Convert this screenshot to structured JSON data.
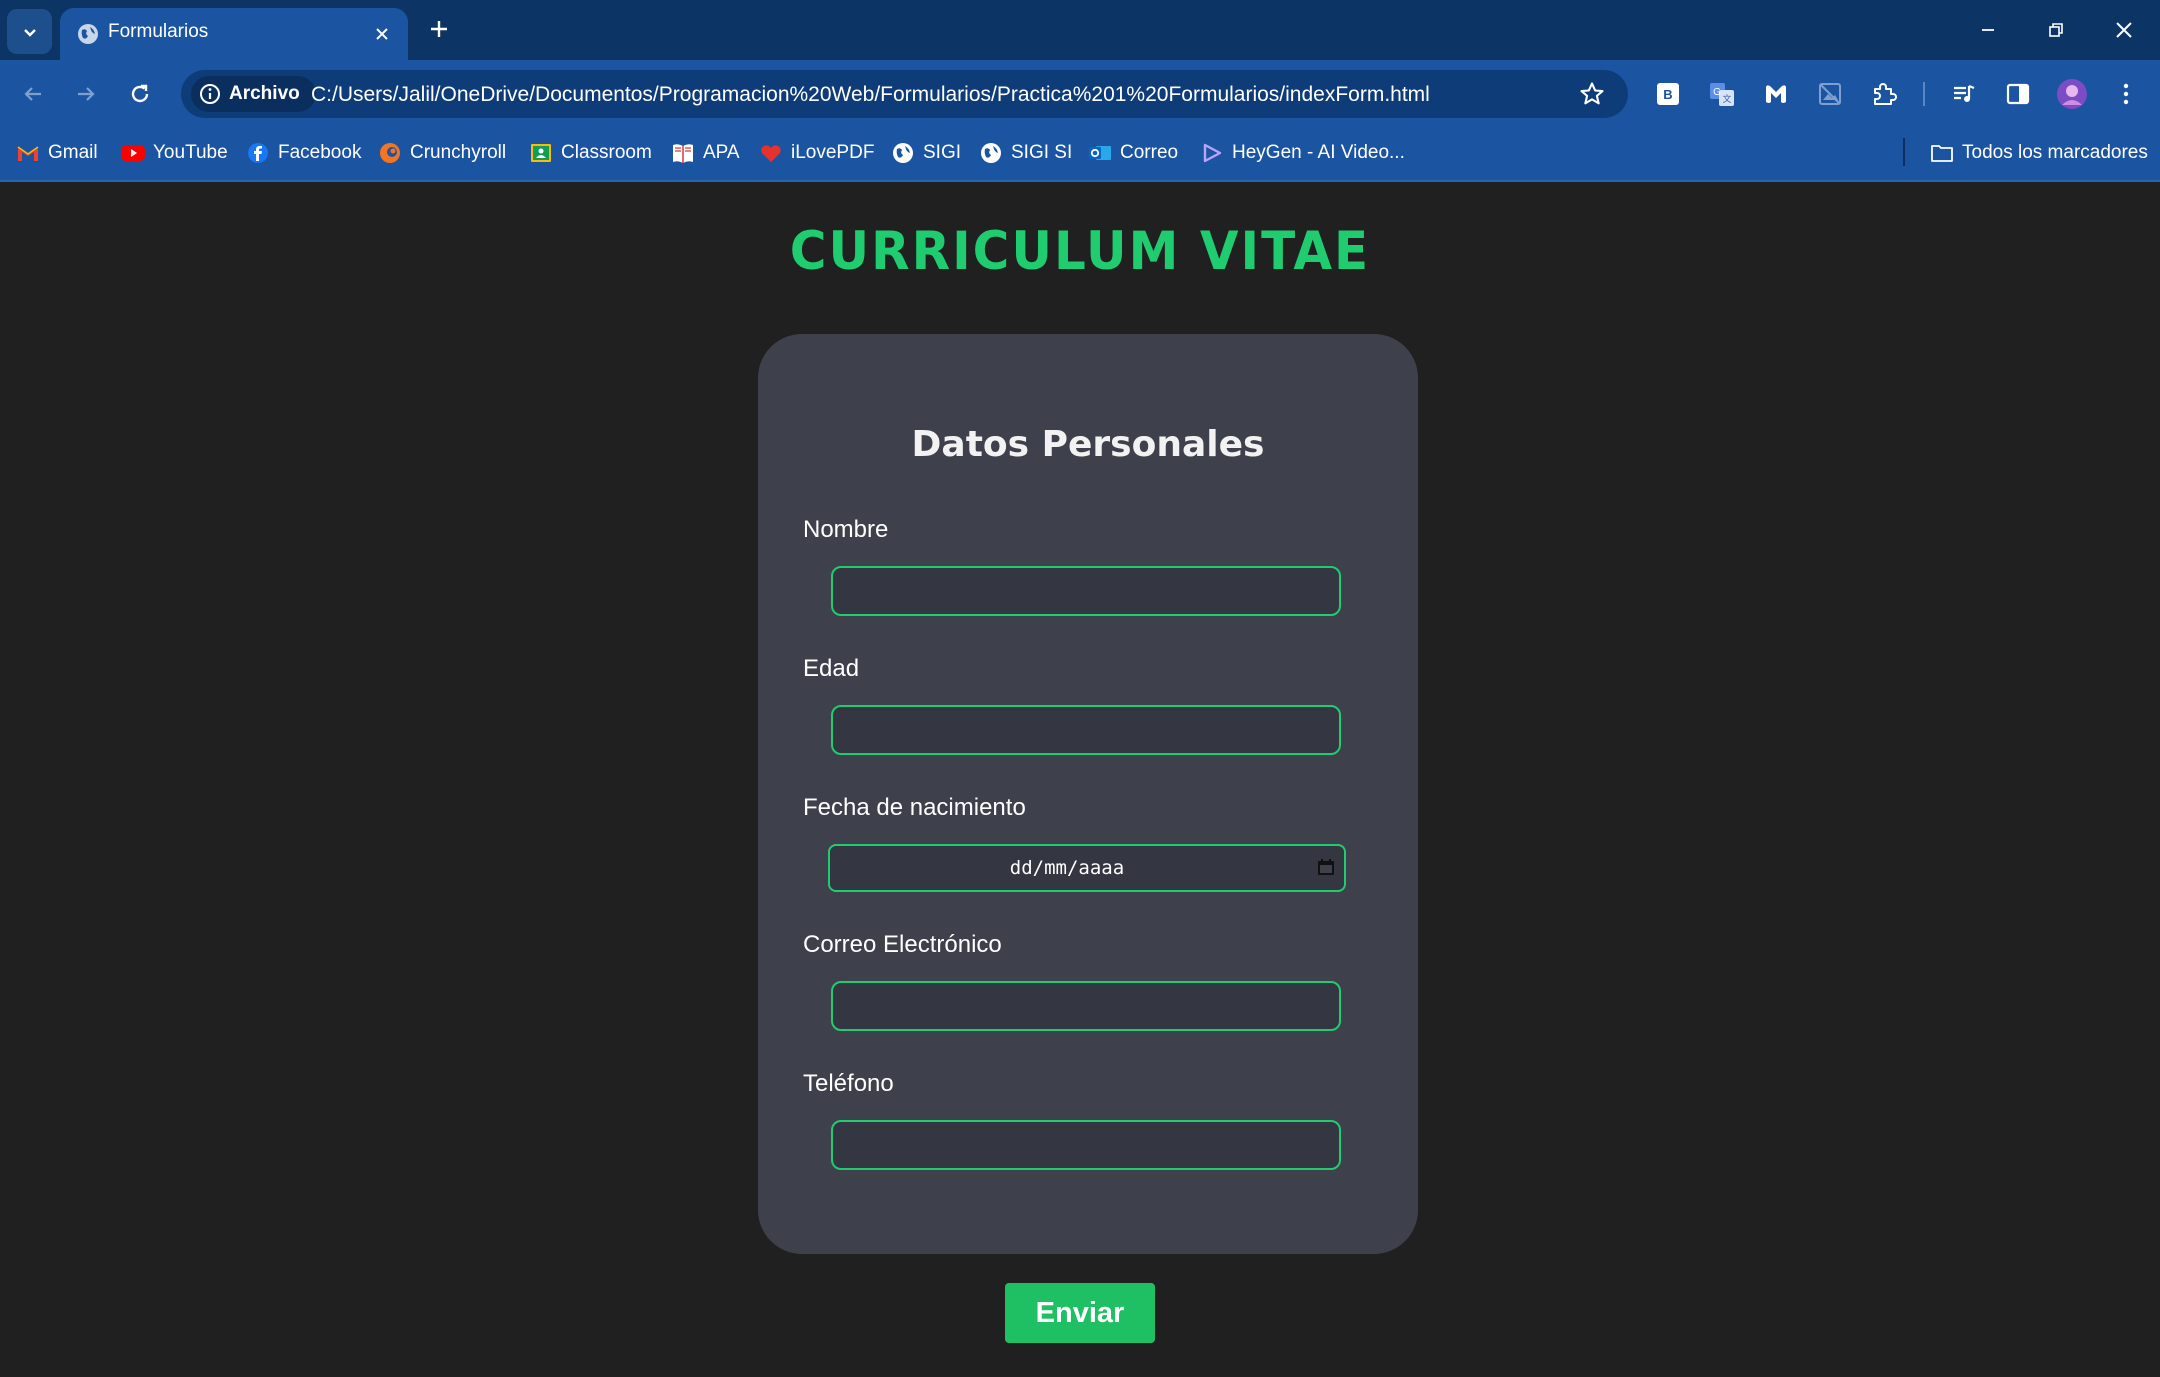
{
  "browser": {
    "tab_title": "Formularios",
    "site_chip_label": "Archivo",
    "url": "C:/Users/Jalil/OneDrive/Documentos/Programacion%20Web/Formularios/Practica%201%20Formularios/indexForm.html",
    "extensions": [
      "bitwarden-icon",
      "google-translate-icon",
      "malwarebytes-icon",
      "image-icon",
      "extensions-icon",
      "media-icon",
      "side-panel-icon",
      "profile-avatar",
      "more-menu-icon"
    ]
  },
  "bookmarks": {
    "items": [
      {
        "label": "Gmail",
        "icon": "gmail-icon"
      },
      {
        "label": "YouTube",
        "icon": "youtube-icon"
      },
      {
        "label": "Facebook",
        "icon": "facebook-icon"
      },
      {
        "label": "Crunchyroll",
        "icon": "crunchyroll-icon"
      },
      {
        "label": "Classroom",
        "icon": "classroom-icon"
      },
      {
        "label": "APA",
        "icon": "book-icon"
      },
      {
        "label": "iLovePDF",
        "icon": "ilovepdf-icon"
      },
      {
        "label": "SIGI",
        "icon": "globe-icon"
      },
      {
        "label": "SIGI SI",
        "icon": "globe-icon"
      },
      {
        "label": "Correo",
        "icon": "outlook-icon"
      },
      {
        "label": "HeyGen - AI Video...",
        "icon": "heygen-icon"
      }
    ],
    "all_bookmarks_label": "Todos los marcadores"
  },
  "page": {
    "title": "CURRICULUM VITAE",
    "section_title": "Datos Personales",
    "fields": [
      {
        "label": "Nombre",
        "value": ""
      },
      {
        "label": "Edad",
        "value": ""
      },
      {
        "label": "Fecha de nacimiento",
        "placeholder": "dd/mm/aaaa"
      },
      {
        "label": "Correo Electrónico",
        "value": ""
      },
      {
        "label": "Teléfono",
        "value": ""
      }
    ],
    "submit_label": "Enviar"
  },
  "colors": {
    "accent": "#1fcc6f",
    "card_bg": "#3e404b",
    "page_bg": "#202020",
    "chrome_blue": "#1b54a1"
  }
}
